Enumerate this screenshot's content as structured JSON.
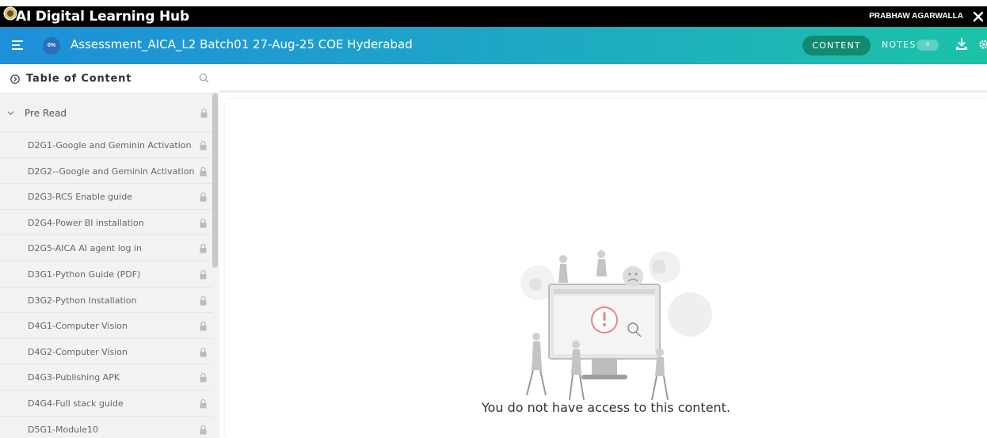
{
  "titlebar": {
    "app_title": "AI Digital Learning Hub",
    "user_name": "PRABHAW AGARWALLA"
  },
  "header": {
    "progress": "0%",
    "course_title": "Assessment_AICA_L2 Batch01 27-Aug-25 COE Hyderabad",
    "content_label": "CONTENT",
    "notes_label": "NOTES",
    "notes_count": "0"
  },
  "sidebar": {
    "toc_title": "Table of Content",
    "section": {
      "label": "Pre Read",
      "expanded": true,
      "locked": true
    },
    "items": [
      {
        "label": "D2G1-Google and Geminin Activation",
        "locked": true
      },
      {
        "label": "D2G2--Google and Geminin Activation",
        "locked": true
      },
      {
        "label": "D2G3-RCS Enable guide",
        "locked": true
      },
      {
        "label": "D2G4-Power BI installation",
        "locked": true
      },
      {
        "label": "D2G5-AICA AI agent log in",
        "locked": true
      },
      {
        "label": "D3G1-Python Guide (PDF)",
        "locked": true
      },
      {
        "label": "D3G2-Python Installation",
        "locked": true
      },
      {
        "label": "D4G1-Computer Vision",
        "locked": true
      },
      {
        "label": "D4G2-Computer Vision",
        "locked": true
      },
      {
        "label": "D4G3-Publishing APK",
        "locked": true
      },
      {
        "label": "D4G4-Full stack guide",
        "locked": true
      },
      {
        "label": "D5G1-Module10",
        "locked": true
      }
    ]
  },
  "main": {
    "message": "You do not have access to this content."
  },
  "colors": {
    "header_gradient_start": "#1e8fd9",
    "header_gradient_end": "#1cc2a8",
    "content_button": "#138a6f",
    "error_accent": "#f08080"
  }
}
